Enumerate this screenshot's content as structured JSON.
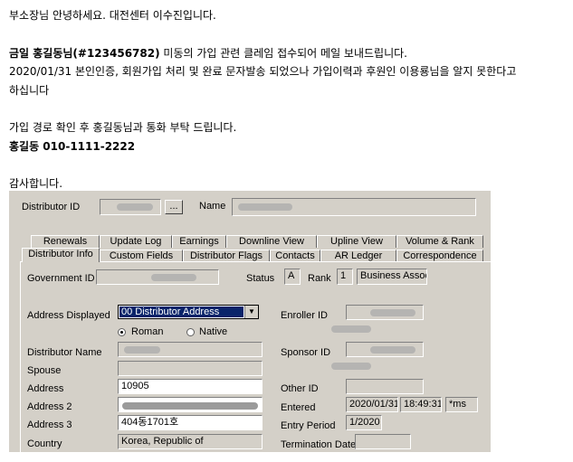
{
  "email": {
    "line1": "부소장님 안녕하세요. 대전센터 이수진입니다.",
    "line2_name": "금일 홍길동님(#123456782)",
    "line2_rest": " 미동의 가입 관련 클레임 접수되어 메일 보내드립니다.",
    "line3": "2020/01/31 본인인증, 회원가입 처리 및 완료 문자발송 되었으나 가입이력과 후원인 이용룡님을 알지 못한다고",
    "line4": "하십니다",
    "line5": "가입 경로 확인 후 홍길동님과 통화 부탁 드립니다.",
    "line6": "홍길동 010-1111-2222",
    "line7": "감사합니다."
  },
  "window": {
    "distributor_id_label": "Distributor ID",
    "browse_button": "...",
    "name_label": "Name",
    "tabs_back": [
      "Renewals",
      "Update Log",
      "Earnings",
      "Downline View",
      "Upline View",
      "Volume & Rank"
    ],
    "tabs_front": [
      "Distributor Info",
      "Custom Fields",
      "Distributor Flags",
      "Contacts",
      "AR Ledger",
      "Correspondence"
    ],
    "form": {
      "government_id_label": "Government ID",
      "status_label": "Status",
      "status_value": "A",
      "rank_label": "Rank",
      "rank_value": "1",
      "rank_name": "Business Associate",
      "address_displayed_label": "Address Displayed",
      "address_displayed_value": "00 Distributor Address",
      "radio_roman": "Roman",
      "radio_native": "Native",
      "distributor_name_label": "Distributor Name",
      "spouse_label": "Spouse",
      "address_label": "Address",
      "address_value": "10905",
      "address2_label": "Address 2",
      "address3_label": "Address 3",
      "address3_value": "404동1701호",
      "country_label": "Country",
      "country_value": "Korea, Republic of",
      "enroller_id_label": "Enroller ID",
      "sponsor_id_label": "Sponsor ID",
      "other_id_label": "Other ID",
      "entered_label": "Entered",
      "entered_date": "2020/01/31",
      "entered_time": "18:49:31",
      "entered_user": "*ms",
      "entry_period_label": "Entry Period",
      "entry_period_value": "1/2020",
      "termination_date_label": "Termination Date"
    }
  }
}
